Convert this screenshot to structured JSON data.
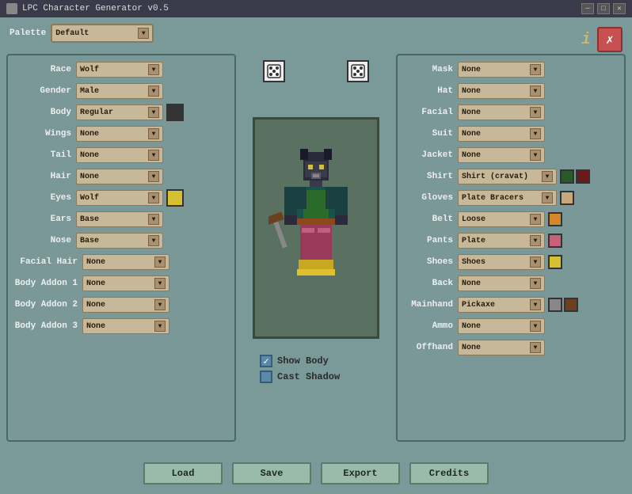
{
  "titlebar": {
    "title": "LPC Character Generator v0.5",
    "icon": "game-icon",
    "controls": [
      "minimize",
      "maximize",
      "close"
    ]
  },
  "top": {
    "palette_label": "Palette",
    "palette_value": "Default",
    "info_btn": "i",
    "close_btn": "✗"
  },
  "left_panel": {
    "rows": [
      {
        "label": "Race",
        "value": "Wolf",
        "has_color": false
      },
      {
        "label": "Gender",
        "value": "Male",
        "has_color": false
      },
      {
        "label": "Body",
        "value": "Regular",
        "has_color": true,
        "color": "#333"
      },
      {
        "label": "Wings",
        "value": "None",
        "has_color": false
      },
      {
        "label": "Tail",
        "value": "None",
        "has_color": false
      },
      {
        "label": "Hair",
        "value": "None",
        "has_color": false
      },
      {
        "label": "Eyes",
        "value": "Wolf",
        "has_color": true,
        "color": "#d4c030"
      },
      {
        "label": "Ears",
        "value": "Base",
        "has_color": false
      },
      {
        "label": "Nose",
        "value": "Base",
        "has_color": false
      },
      {
        "label": "Facial Hair",
        "value": "None",
        "has_color": false
      },
      {
        "label": "Body Addon 1",
        "value": "None",
        "has_color": false
      },
      {
        "label": "Body Addon 2",
        "value": "None",
        "has_color": false
      },
      {
        "label": "Body Addon 3",
        "value": "None",
        "has_color": false
      }
    ]
  },
  "right_panel": {
    "rows": [
      {
        "label": "Mask",
        "value": "None",
        "swatches": []
      },
      {
        "label": "Hat",
        "value": "None",
        "swatches": []
      },
      {
        "label": "Facial",
        "value": "None",
        "swatches": []
      },
      {
        "label": "Suit",
        "value": "None",
        "swatches": []
      },
      {
        "label": "Jacket",
        "value": "None",
        "swatches": []
      },
      {
        "label": "Shirt",
        "value": "Shirt (cravat)",
        "swatches": [
          "#2a5a2a",
          "#6a1a1a"
        ]
      },
      {
        "label": "Gloves",
        "value": "Plate Bracers",
        "swatches": [
          "#c8a878"
        ]
      },
      {
        "label": "Belt",
        "value": "Loose",
        "swatches": [
          "#d4882a"
        ]
      },
      {
        "label": "Pants",
        "value": "Plate",
        "swatches": [
          "#c8607a"
        ]
      },
      {
        "label": "Shoes",
        "value": "Shoes",
        "swatches": [
          "#d4c030"
        ]
      },
      {
        "label": "Back",
        "value": "None",
        "swatches": []
      },
      {
        "label": "Mainhand",
        "value": "Pickaxe",
        "swatches": [
          "#888",
          "#6a4020"
        ]
      },
      {
        "label": "Ammo",
        "value": "None",
        "swatches": []
      },
      {
        "label": "Offhand",
        "value": "None",
        "swatches": []
      }
    ]
  },
  "checkboxes": [
    {
      "label": "Show Body",
      "checked": true
    },
    {
      "label": "Cast Shadow",
      "checked": false
    }
  ],
  "bottom_buttons": [
    "Load",
    "Save",
    "Export",
    "Credits"
  ],
  "dice1": "⚄",
  "dice2": "⚄"
}
